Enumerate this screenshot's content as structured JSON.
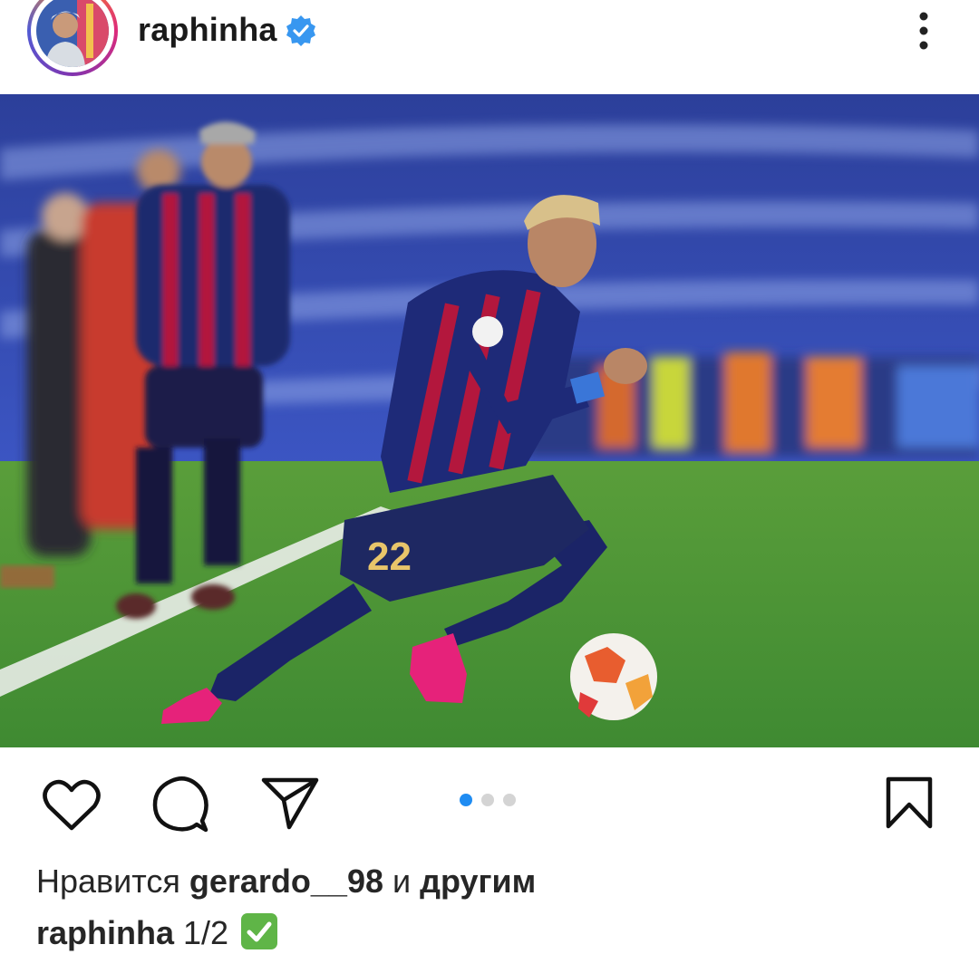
{
  "post": {
    "username": "raphinha",
    "verified": true,
    "more_icon": "more-vertical-icon",
    "photo": {
      "alt_subject": "football player in blue-red striped kit number 22 dribbling a ball",
      "jersey_number": "22",
      "carousel": {
        "total": 3,
        "active_index": 0
      }
    },
    "actions": {
      "like_icon": "heart-icon",
      "comment_icon": "comment-icon",
      "share_icon": "send-icon",
      "save_icon": "bookmark-icon"
    },
    "likes": {
      "prefix": "Нравится",
      "user": "gerardo__98",
      "conj": "и",
      "suffix": "другим"
    },
    "caption": {
      "user": "raphinha",
      "text": "1/2",
      "emoji": "check-mark-button-icon"
    }
  },
  "colors": {
    "accent_blue": "#1f8cf2",
    "verified_blue": "#3897f0",
    "kit_blue": "#1b2a6b",
    "kit_red": "#b3173d",
    "pitch_green": "#3f8a32"
  }
}
